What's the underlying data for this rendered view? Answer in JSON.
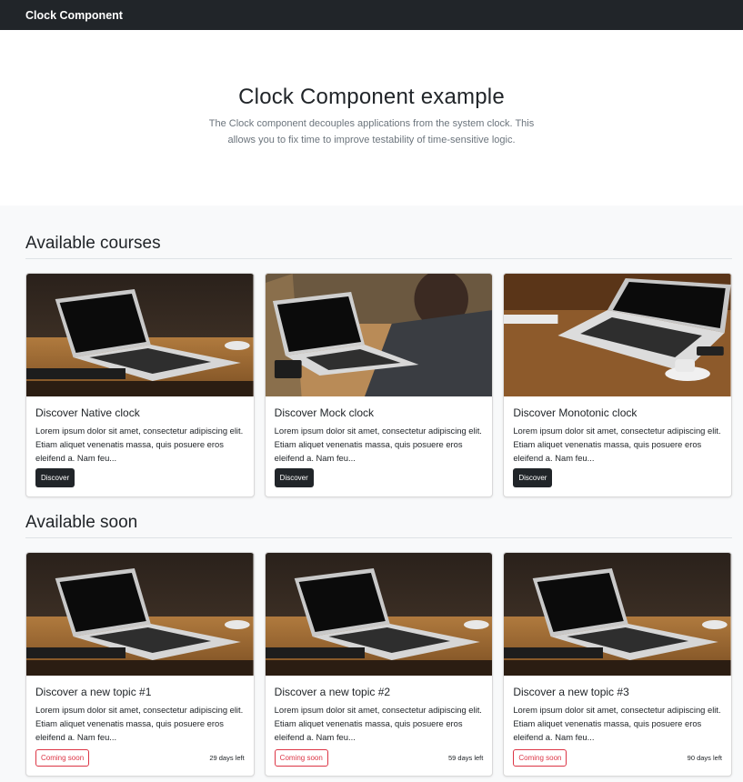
{
  "navbar": {
    "brand": "Clock Component"
  },
  "hero": {
    "title": "Clock Component example",
    "description": "The Clock component decouples applications from the system clock. This allows you to fix time to improve testability of time-sensitive logic."
  },
  "available": {
    "title": "Available courses",
    "cards": [
      {
        "title": "Discover Native clock",
        "text": "Lorem ipsum dolor sit amet, consectetur adipiscing elit. Etiam aliquet venenatis massa, quis posuere eros eleifend a. Nam feu...",
        "button": "Discover"
      },
      {
        "title": "Discover Mock clock",
        "text": "Lorem ipsum dolor sit amet, consectetur adipiscing elit. Etiam aliquet venenatis massa, quis posuere eros eleifend a. Nam feu...",
        "button": "Discover"
      },
      {
        "title": "Discover Monotonic clock",
        "text": "Lorem ipsum dolor sit amet, consectetur adipiscing elit. Etiam aliquet venenatis massa, quis posuere eros eleifend a. Nam feu...",
        "button": "Discover"
      }
    ]
  },
  "soon": {
    "title": "Available soon",
    "cards": [
      {
        "title": "Discover a new topic #1",
        "text": "Lorem ipsum dolor sit amet, consectetur adipiscing elit. Etiam aliquet venenatis massa, quis posuere eros eleifend a. Nam feu...",
        "badge": "Coming soon",
        "days": "29 days left"
      },
      {
        "title": "Discover a new topic #2",
        "text": "Lorem ipsum dolor sit amet, consectetur adipiscing elit. Etiam aliquet venenatis massa, quis posuere eros eleifend a. Nam feu...",
        "badge": "Coming soon",
        "days": "59 days left"
      },
      {
        "title": "Discover a new topic #3",
        "text": "Lorem ipsum dolor sit amet, consectetur adipiscing elit. Etiam aliquet venenatis massa, quis posuere eros eleifend a. Nam feu...",
        "badge": "Coming soon",
        "days": "90 days left"
      }
    ]
  },
  "colors": {
    "navbar": "#212529",
    "accent_danger": "#dc3545",
    "section_bg": "#f8f9fa"
  }
}
